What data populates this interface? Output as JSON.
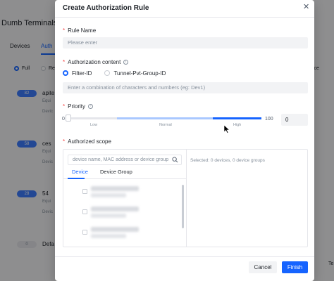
{
  "background": {
    "title": "Dumb Terminals",
    "tabs": [
      "Devices",
      "Auth"
    ],
    "filters": [
      "Full",
      "Re"
    ],
    "right_label": "ice",
    "right_bottom": "Te",
    "cards": [
      {
        "badge": "82",
        "name": "apite",
        "sub1": "Equi",
        "sub2": "Devic"
      },
      {
        "badge": "58",
        "name": "ces",
        "sub1": "Equi",
        "sub2": "Devic"
      },
      {
        "badge": "28",
        "name": "54",
        "sub1": "Equi",
        "sub2": "Devic"
      },
      {
        "badge": "0",
        "name": "Defa",
        "sub1": "",
        "sub2": ""
      }
    ]
  },
  "modal": {
    "title": "Create Authorization Rule",
    "close_icon": "close-icon"
  },
  "form": {
    "rule_name": {
      "label": "Rule Name",
      "placeholder": "Please enter"
    },
    "auth_content": {
      "label": "Authorization content",
      "options": [
        "Filter-ID",
        "Tunnel-Pvt-Group-ID"
      ],
      "selected": "Filter-ID",
      "placeholder": "Enter a combination of characters and numbers (eg: Dev1)"
    },
    "priority": {
      "label": "Priority",
      "min_label": "0",
      "max_label": "100",
      "ticks": [
        "Low",
        "Normal",
        "High"
      ],
      "value": "0"
    },
    "scope": {
      "label": "Authorized scope",
      "search_placeholder": "device name, MAC address or device group",
      "tabs": [
        "Device",
        "Device Group"
      ],
      "active_tab": "Device",
      "selected_text": "Selected: 0 devices, 0 device groups"
    }
  },
  "footer": {
    "cancel_label": "Cancel",
    "finish_label": "Finish"
  },
  "colors": {
    "accent": "#1664ff",
    "required": "#f53f3f"
  }
}
